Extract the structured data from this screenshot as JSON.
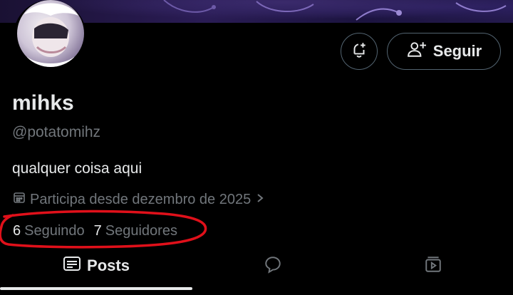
{
  "profile": {
    "name": "mihks",
    "handle": "@potatomihz",
    "bio": "qualquer coisa aqui",
    "joined": "Participa desde dezembro de 2025"
  },
  "actions": {
    "follow_label": "Seguir"
  },
  "stats": {
    "following_count": "6",
    "following_label": "Seguindo",
    "followers_count": "7",
    "followers_label": "Seguidores"
  },
  "tabs": [
    {
      "label": "Posts",
      "icon": "posts-icon",
      "selected": true
    },
    {
      "label": "",
      "icon": "replies-icon",
      "selected": false
    },
    {
      "label": "",
      "icon": "media-icon",
      "selected": false
    }
  ],
  "colors": {
    "background": "#000000",
    "text": "#e7e9ea",
    "secondary_text": "#71767b",
    "border": "#536471",
    "annotation": "#e0101a"
  }
}
